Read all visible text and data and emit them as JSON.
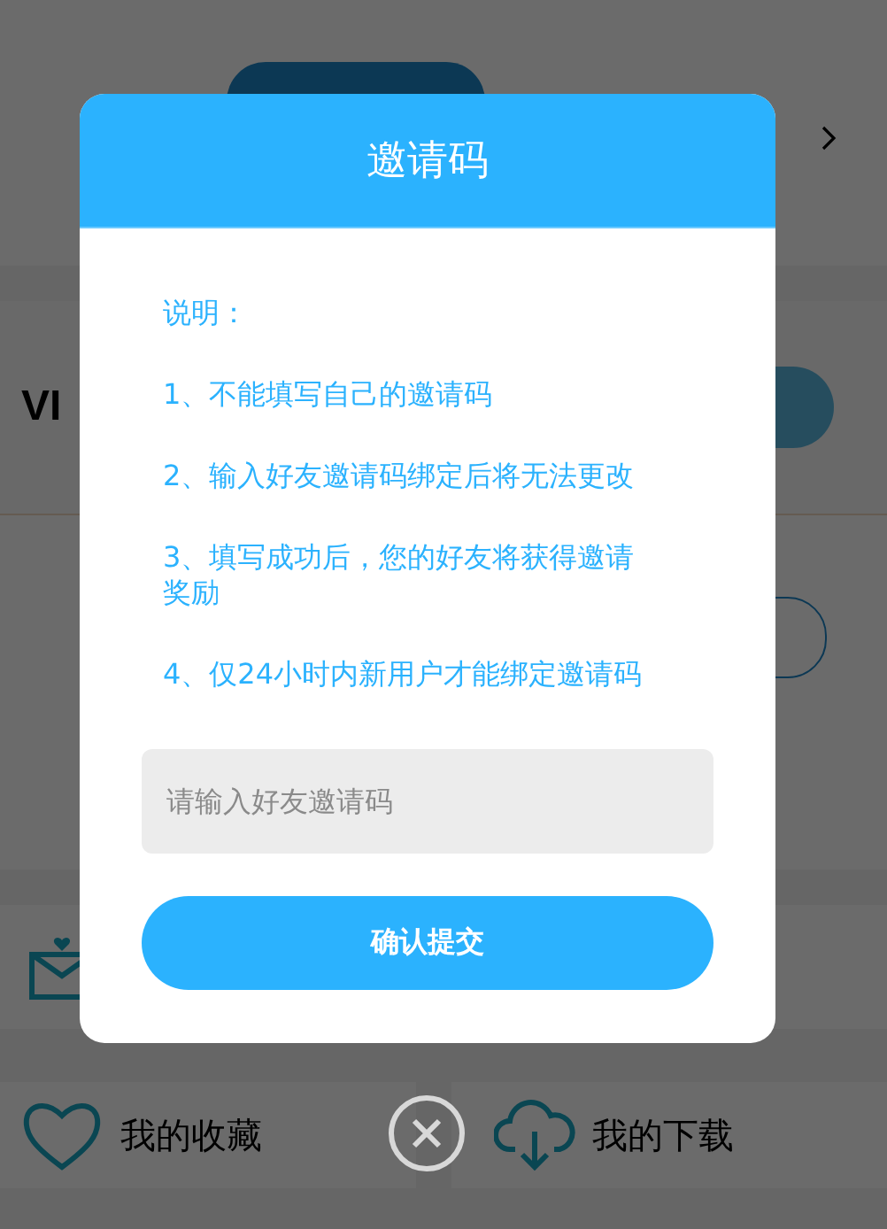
{
  "background": {
    "vip_label": "VI",
    "menu": [
      {
        "label": "我的收藏"
      },
      {
        "label": "我的下载"
      }
    ]
  },
  "dialog": {
    "title": "邀请码",
    "lines": [
      "说明：",
      "1、不能填写自己的邀请码",
      "2、输入好友邀请码绑定后将无法更改",
      "3、填写成功后，您的好友将获得邀请奖励",
      "4、仅24小时内新用户才能绑定邀请码"
    ],
    "input": {
      "placeholder": "请输入好友邀请码"
    },
    "submit": "确认提交"
  }
}
